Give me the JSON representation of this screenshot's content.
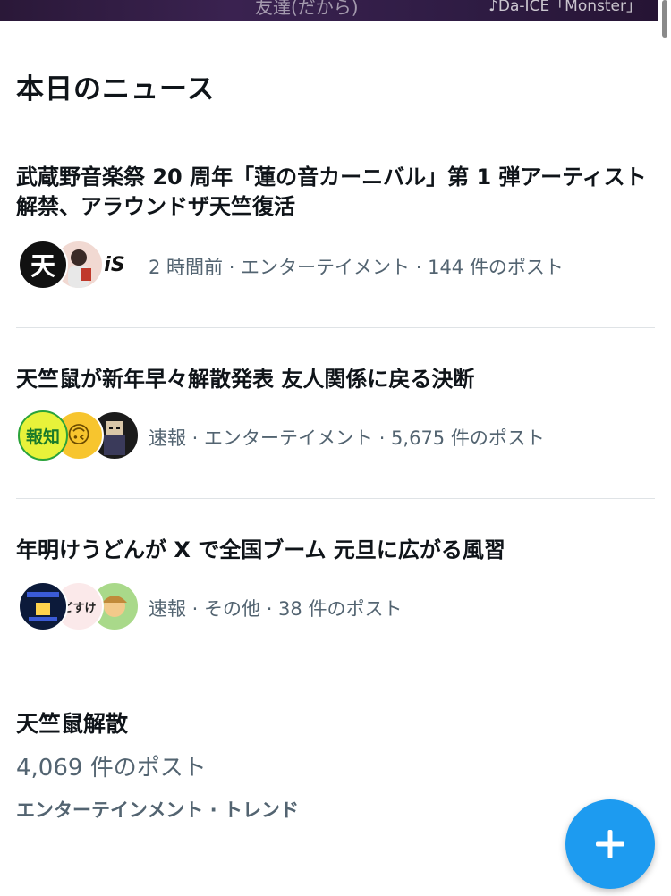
{
  "banner": {
    "text": "友達(だから)",
    "caption": "♪Da-ICE「Monster」"
  },
  "section": {
    "title": "本日のニュース"
  },
  "news": [
    {
      "title": "武蔵野音楽祭 20 周年「蓮の音カーニバル」第 1 弾アーティスト解禁、アラウンドザ天竺復活",
      "meta": "2 時間前 · エンターテイメント · 144 件のポスト",
      "avatars": [
        {
          "label": "天",
          "bg": "#111111",
          "fg": "#ffffff"
        },
        {
          "label": "",
          "bg": "#f1d9d2",
          "fg": "#c0392b"
        },
        {
          "label": "iS",
          "bg": "#ffffff",
          "fg": "#111111"
        }
      ]
    },
    {
      "title": "天竺鼠が新年早々解散発表 友人関係に戻る決断",
      "meta": "速報 · エンターテイメント · 5,675 件のポスト",
      "avatars": [
        {
          "label": "報知",
          "bg": "#e8f23a",
          "fg": "#1a7a2a"
        },
        {
          "label": "🙃",
          "bg": "#f7c52e",
          "fg": "#6b4b00"
        },
        {
          "label": "",
          "bg": "#1b1b1b",
          "fg": "#cfcfcf"
        }
      ]
    },
    {
      "title": "年明けうどんが X で全国ブーム 元旦に広がる風習",
      "meta": "速報 · その他 · 38 件のポスト",
      "avatars": [
        {
          "label": "",
          "bg": "#0c1a3a",
          "fg": "#ffd34d"
        },
        {
          "label": "どすけ",
          "bg": "#fbe9ea",
          "fg": "#222222"
        },
        {
          "label": "",
          "bg": "#a9d98a",
          "fg": "#a06a2a"
        }
      ]
    }
  ],
  "trend": {
    "name": "天竺鼠解散",
    "count": "4,069 件のポスト",
    "category": "エンターテインメント · トレンド"
  },
  "fab": {
    "symbol": "+"
  }
}
